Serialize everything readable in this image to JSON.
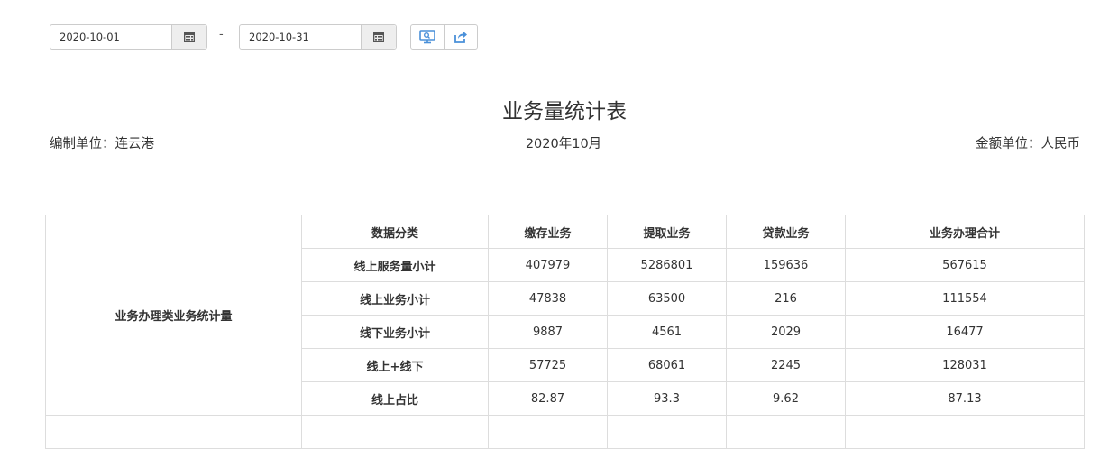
{
  "filters": {
    "start_date": "2020-10-01",
    "end_date": "2020-10-31",
    "separator": "-",
    "buttons": [
      "display-icon",
      "share-icon"
    ]
  },
  "report": {
    "title": "业务量统计表",
    "unit_left": "编制单位：连云港",
    "period": "2020年10月",
    "unit_right": "金额单位：人民币"
  },
  "table": {
    "row_group": "业务办理类业务统计量",
    "headers": [
      "数据分类",
      "缴存业务",
      "提取业务",
      "贷款业务",
      "业务办理合计"
    ],
    "rows": [
      {
        "label": "线上服务量小计",
        "values": [
          "407979",
          "5286801",
          "159636",
          "567615"
        ]
      },
      {
        "label": "线上业务小计",
        "values": [
          "47838",
          "63500",
          "216",
          "111554"
        ]
      },
      {
        "label": "线下业务小计",
        "values": [
          "9887",
          "4561",
          "2029",
          "16477"
        ]
      },
      {
        "label": "线上+线下",
        "values": [
          "57725",
          "68061",
          "2245",
          "128031"
        ]
      },
      {
        "label": "线上占比",
        "values": [
          "82.87",
          "93.3",
          "9.62",
          "87.13"
        ]
      }
    ]
  },
  "colors": {
    "icon_blue": "#4a90d9",
    "border": "#dddddd"
  }
}
